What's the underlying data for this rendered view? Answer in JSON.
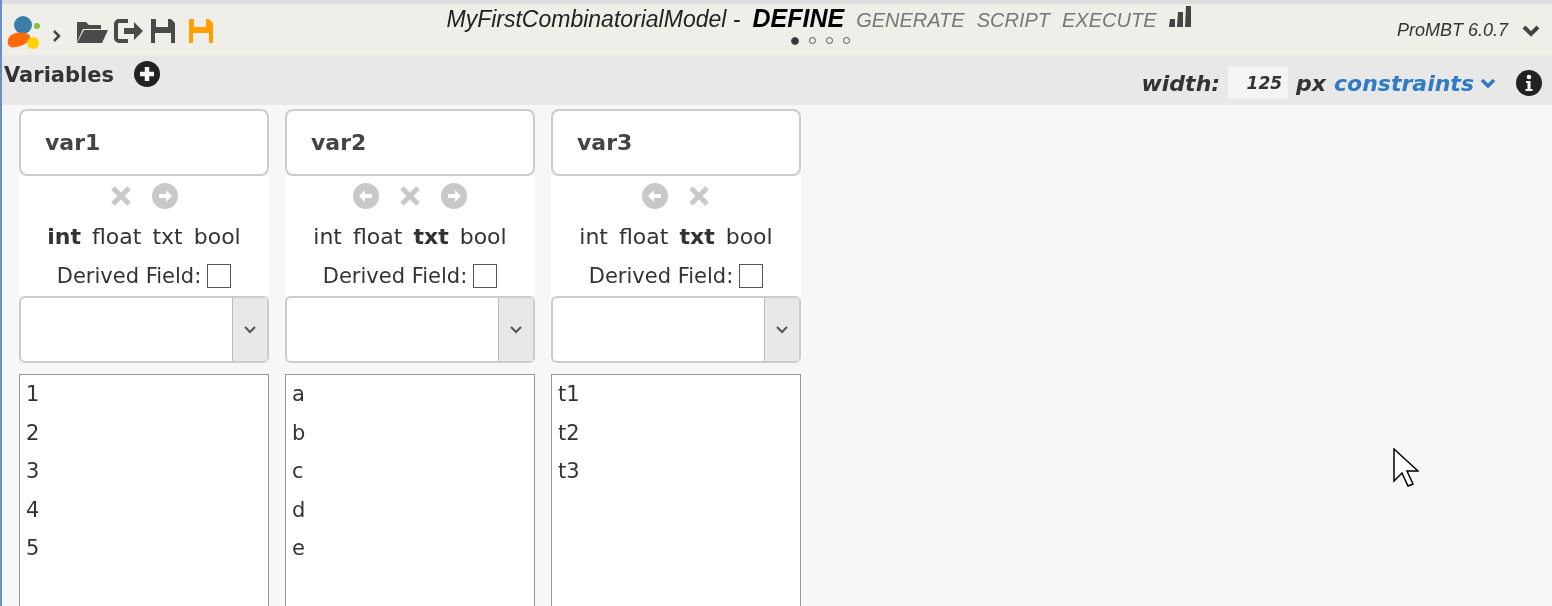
{
  "header": {
    "title": "MyFirstCombinatorialModel -",
    "tabs": [
      {
        "label": "DEFINE",
        "selected": true
      },
      {
        "label": "GENERATE",
        "selected": false
      },
      {
        "label": "SCRIPT",
        "selected": false
      },
      {
        "label": "EXECUTE",
        "selected": false
      }
    ],
    "steps": [
      {
        "selected": true
      },
      {
        "selected": false
      },
      {
        "selected": false
      },
      {
        "selected": false
      }
    ],
    "version": "ProMBT 6.0.7"
  },
  "toolbar": {
    "title": "Variables",
    "width_label": "width:",
    "width_value": "125",
    "unit": "px",
    "constraints": "constraints"
  },
  "variables": [
    {
      "name": "var1",
      "has_prev": false,
      "has_next": true,
      "types": [
        {
          "label": "int",
          "selected": true
        },
        {
          "label": "float",
          "selected": false
        },
        {
          "label": "txt",
          "selected": false
        },
        {
          "label": "bool",
          "selected": false
        }
      ],
      "derived_label": "Derived Field:",
      "derived": false,
      "values": [
        "1",
        "2",
        "3",
        "4",
        "5"
      ]
    },
    {
      "name": "var2",
      "has_prev": true,
      "has_next": true,
      "types": [
        {
          "label": "int",
          "selected": false
        },
        {
          "label": "float",
          "selected": false
        },
        {
          "label": "txt",
          "selected": true
        },
        {
          "label": "bool",
          "selected": false
        }
      ],
      "derived_label": "Derived Field:",
      "derived": false,
      "values": [
        "a",
        "b",
        "c",
        "d",
        "e"
      ]
    },
    {
      "name": "var3",
      "has_prev": true,
      "has_next": false,
      "types": [
        {
          "label": "int",
          "selected": false
        },
        {
          "label": "float",
          "selected": false
        },
        {
          "label": "txt",
          "selected": true
        },
        {
          "label": "bool",
          "selected": false
        }
      ],
      "derived_label": "Derived Field:",
      "derived": false,
      "values": [
        "t1",
        "t2",
        "t3"
      ]
    }
  ]
}
